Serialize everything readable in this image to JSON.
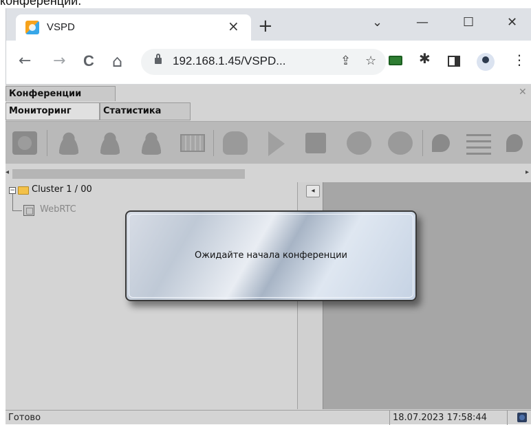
{
  "top_cut_text": "конференции.",
  "browser": {
    "tab_title": "VSPD",
    "tab_close": "×",
    "new_tab": "+",
    "win_dropdown": "⌄",
    "win_minimize": "—",
    "win_maximize": "☐",
    "win_close": "✕",
    "back": "←",
    "forward": "→",
    "reload": "C",
    "home": "⌂",
    "url": "192.168.1.45/VSPD...",
    "share": "⇪",
    "bookmark": "☆",
    "puzzle": "✱",
    "menu": "⋮"
  },
  "app": {
    "title_tab": "Конференции",
    "close": "✕",
    "subtabs": [
      "Мониторинг",
      "Статистика"
    ],
    "tree": {
      "root_label": "Cluster 1 / 00",
      "child_label": "WebRTC"
    },
    "collapse_icon": "◂",
    "dialog_text": "Ожидайте начала конференции",
    "status_left": "Готово",
    "status_right": "18.07.2023 17:58:44"
  }
}
